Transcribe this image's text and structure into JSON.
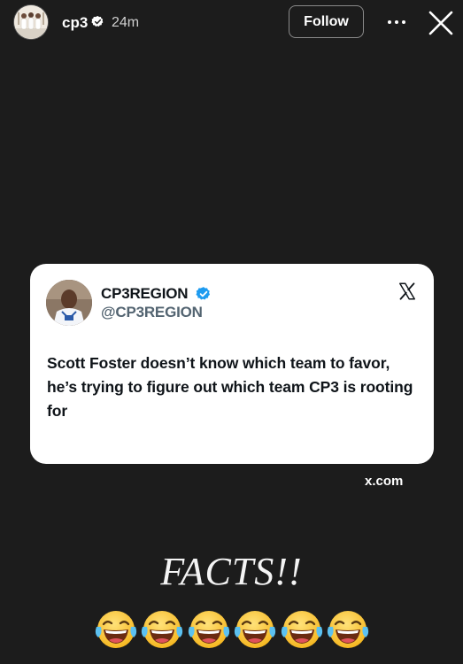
{
  "story_header": {
    "username": "cp3",
    "time_ago": "24m",
    "follow_label": "Follow",
    "icons": {
      "avatar": "avatar",
      "verified": "verified-badge-icon",
      "more": "more-options-icon",
      "close": "close-icon"
    }
  },
  "tweet": {
    "display_name": "CP3REGION",
    "handle": "@CP3REGION",
    "text": "Scott Foster doesn’t know which team to favor, he’s trying to figure out which team CP3 is rooting for",
    "verified_color": "#1d9bf0",
    "platform_icon": "x-logo-icon"
  },
  "link_sticker": {
    "label": "x.com"
  },
  "caption": {
    "text": "FACTS!!",
    "emoji_name": "face-with-tears-of-joy-emoji",
    "emoji_count": 6
  },
  "colors": {
    "background": "#1c1c1c",
    "card": "#ffffff",
    "tweet_text": "#0f1419",
    "handle": "#536471"
  }
}
